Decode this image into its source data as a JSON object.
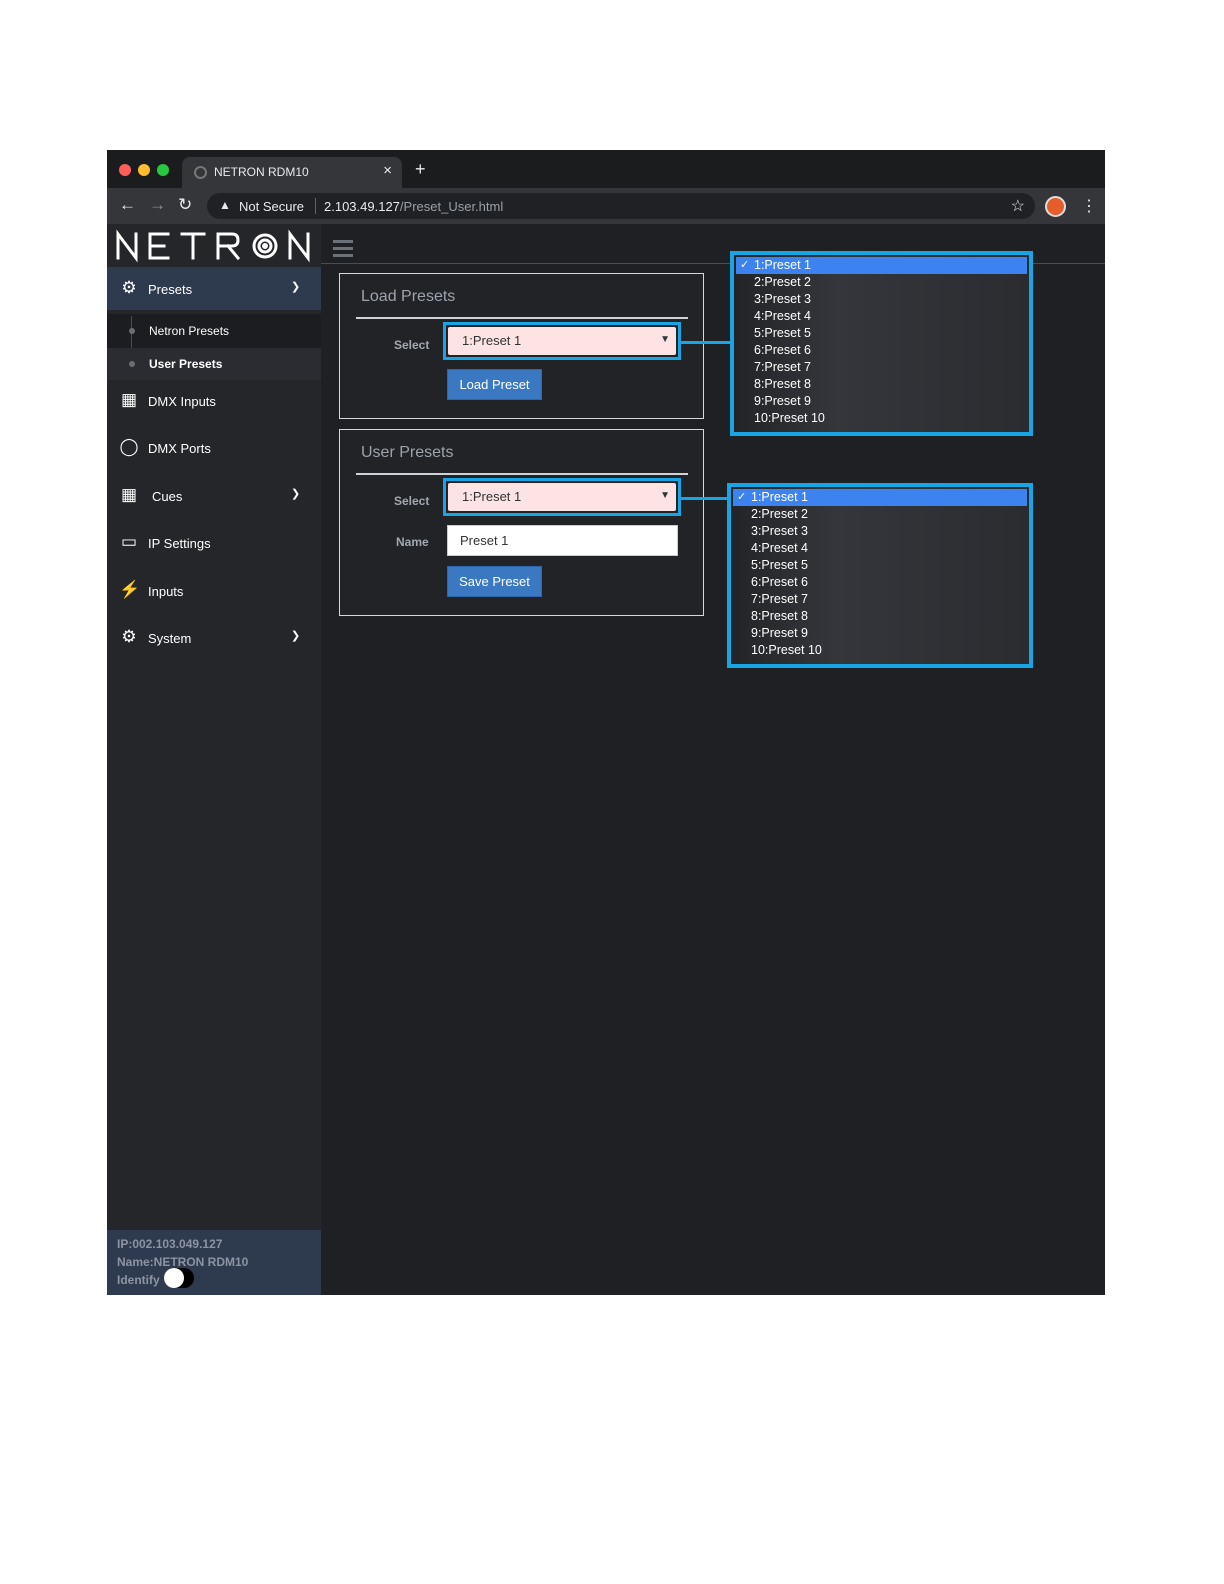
{
  "browser": {
    "tab_title": "NETRON RDM10",
    "new_tab": "+",
    "close": "×",
    "security_label": "Not Secure",
    "url_host": "2.103.49.127",
    "url_path": "/Preset_User.html"
  },
  "app": {
    "logo_text": "NETRON"
  },
  "sidebar": {
    "items": [
      {
        "label": "Presets",
        "icon": "gear-icon",
        "expanded": true
      },
      {
        "label": "DMX Inputs",
        "icon": "edit-box-icon"
      },
      {
        "label": "DMX Ports",
        "icon": "ring-icon"
      },
      {
        "label": "Cues",
        "icon": "film-icon",
        "expanded": false
      },
      {
        "label": "IP Settings",
        "icon": "laptop-icon"
      },
      {
        "label": "Inputs",
        "icon": "plug-icon"
      },
      {
        "label": "System",
        "icon": "gear-icon",
        "expanded": false
      }
    ],
    "sub_items": [
      {
        "label": "Netron Presets"
      },
      {
        "label": "User Presets",
        "active": true
      }
    ],
    "footer": {
      "ip": "IP:002.103.049.127",
      "name": "Name:NETRON RDM10",
      "identify_label": "Identify",
      "identify_on": false
    }
  },
  "load_presets": {
    "title": "Load Presets",
    "select_label": "Select",
    "select_value": "1:Preset 1",
    "button_label": "Load Preset"
  },
  "user_presets": {
    "title": "User Presets",
    "select_label": "Select",
    "select_value": "1:Preset 1",
    "name_label": "Name",
    "name_value": "Preset 1",
    "button_label": "Save Preset"
  },
  "dropdown_options": [
    "1:Preset 1",
    "2:Preset 2",
    "3:Preset 3",
    "4:Preset 4",
    "5:Preset 5",
    "6:Preset 6",
    "7:Preset 7",
    "8:Preset 8",
    "9:Preset 9",
    "10:Preset 10"
  ],
  "colors": {
    "callout_outline": "#17a5e6",
    "selected_option": "#3d83f0",
    "button": "#3b78c2",
    "select_background": "#fde3e3"
  }
}
